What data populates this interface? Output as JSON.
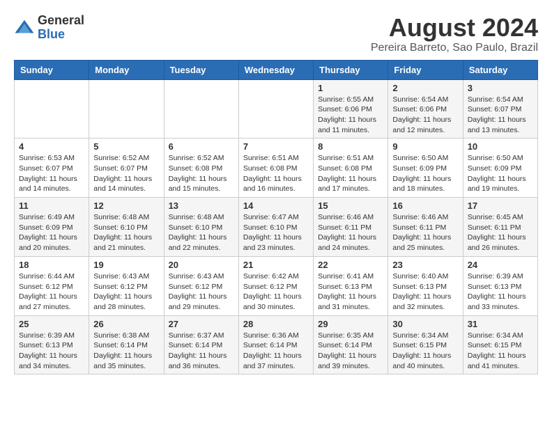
{
  "logo": {
    "general": "General",
    "blue": "Blue"
  },
  "header": {
    "month_year": "August 2024",
    "location": "Pereira Barreto, Sao Paulo, Brazil"
  },
  "weekdays": [
    "Sunday",
    "Monday",
    "Tuesday",
    "Wednesday",
    "Thursday",
    "Friday",
    "Saturday"
  ],
  "weeks": [
    [
      {
        "day": "",
        "info": ""
      },
      {
        "day": "",
        "info": ""
      },
      {
        "day": "",
        "info": ""
      },
      {
        "day": "",
        "info": ""
      },
      {
        "day": "1",
        "info": "Sunrise: 6:55 AM\nSunset: 6:06 PM\nDaylight: 11 hours\nand 11 minutes."
      },
      {
        "day": "2",
        "info": "Sunrise: 6:54 AM\nSunset: 6:06 PM\nDaylight: 11 hours\nand 12 minutes."
      },
      {
        "day": "3",
        "info": "Sunrise: 6:54 AM\nSunset: 6:07 PM\nDaylight: 11 hours\nand 13 minutes."
      }
    ],
    [
      {
        "day": "4",
        "info": "Sunrise: 6:53 AM\nSunset: 6:07 PM\nDaylight: 11 hours\nand 14 minutes."
      },
      {
        "day": "5",
        "info": "Sunrise: 6:52 AM\nSunset: 6:07 PM\nDaylight: 11 hours\nand 14 minutes."
      },
      {
        "day": "6",
        "info": "Sunrise: 6:52 AM\nSunset: 6:08 PM\nDaylight: 11 hours\nand 15 minutes."
      },
      {
        "day": "7",
        "info": "Sunrise: 6:51 AM\nSunset: 6:08 PM\nDaylight: 11 hours\nand 16 minutes."
      },
      {
        "day": "8",
        "info": "Sunrise: 6:51 AM\nSunset: 6:08 PM\nDaylight: 11 hours\nand 17 minutes."
      },
      {
        "day": "9",
        "info": "Sunrise: 6:50 AM\nSunset: 6:09 PM\nDaylight: 11 hours\nand 18 minutes."
      },
      {
        "day": "10",
        "info": "Sunrise: 6:50 AM\nSunset: 6:09 PM\nDaylight: 11 hours\nand 19 minutes."
      }
    ],
    [
      {
        "day": "11",
        "info": "Sunrise: 6:49 AM\nSunset: 6:09 PM\nDaylight: 11 hours\nand 20 minutes."
      },
      {
        "day": "12",
        "info": "Sunrise: 6:48 AM\nSunset: 6:10 PM\nDaylight: 11 hours\nand 21 minutes."
      },
      {
        "day": "13",
        "info": "Sunrise: 6:48 AM\nSunset: 6:10 PM\nDaylight: 11 hours\nand 22 minutes."
      },
      {
        "day": "14",
        "info": "Sunrise: 6:47 AM\nSunset: 6:10 PM\nDaylight: 11 hours\nand 23 minutes."
      },
      {
        "day": "15",
        "info": "Sunrise: 6:46 AM\nSunset: 6:11 PM\nDaylight: 11 hours\nand 24 minutes."
      },
      {
        "day": "16",
        "info": "Sunrise: 6:46 AM\nSunset: 6:11 PM\nDaylight: 11 hours\nand 25 minutes."
      },
      {
        "day": "17",
        "info": "Sunrise: 6:45 AM\nSunset: 6:11 PM\nDaylight: 11 hours\nand 26 minutes."
      }
    ],
    [
      {
        "day": "18",
        "info": "Sunrise: 6:44 AM\nSunset: 6:12 PM\nDaylight: 11 hours\nand 27 minutes."
      },
      {
        "day": "19",
        "info": "Sunrise: 6:43 AM\nSunset: 6:12 PM\nDaylight: 11 hours\nand 28 minutes."
      },
      {
        "day": "20",
        "info": "Sunrise: 6:43 AM\nSunset: 6:12 PM\nDaylight: 11 hours\nand 29 minutes."
      },
      {
        "day": "21",
        "info": "Sunrise: 6:42 AM\nSunset: 6:12 PM\nDaylight: 11 hours\nand 30 minutes."
      },
      {
        "day": "22",
        "info": "Sunrise: 6:41 AM\nSunset: 6:13 PM\nDaylight: 11 hours\nand 31 minutes."
      },
      {
        "day": "23",
        "info": "Sunrise: 6:40 AM\nSunset: 6:13 PM\nDaylight: 11 hours\nand 32 minutes."
      },
      {
        "day": "24",
        "info": "Sunrise: 6:39 AM\nSunset: 6:13 PM\nDaylight: 11 hours\nand 33 minutes."
      }
    ],
    [
      {
        "day": "25",
        "info": "Sunrise: 6:39 AM\nSunset: 6:13 PM\nDaylight: 11 hours\nand 34 minutes."
      },
      {
        "day": "26",
        "info": "Sunrise: 6:38 AM\nSunset: 6:14 PM\nDaylight: 11 hours\nand 35 minutes."
      },
      {
        "day": "27",
        "info": "Sunrise: 6:37 AM\nSunset: 6:14 PM\nDaylight: 11 hours\nand 36 minutes."
      },
      {
        "day": "28",
        "info": "Sunrise: 6:36 AM\nSunset: 6:14 PM\nDaylight: 11 hours\nand 37 minutes."
      },
      {
        "day": "29",
        "info": "Sunrise: 6:35 AM\nSunset: 6:14 PM\nDaylight: 11 hours\nand 39 minutes."
      },
      {
        "day": "30",
        "info": "Sunrise: 6:34 AM\nSunset: 6:15 PM\nDaylight: 11 hours\nand 40 minutes."
      },
      {
        "day": "31",
        "info": "Sunrise: 6:34 AM\nSunset: 6:15 PM\nDaylight: 11 hours\nand 41 minutes."
      }
    ]
  ]
}
